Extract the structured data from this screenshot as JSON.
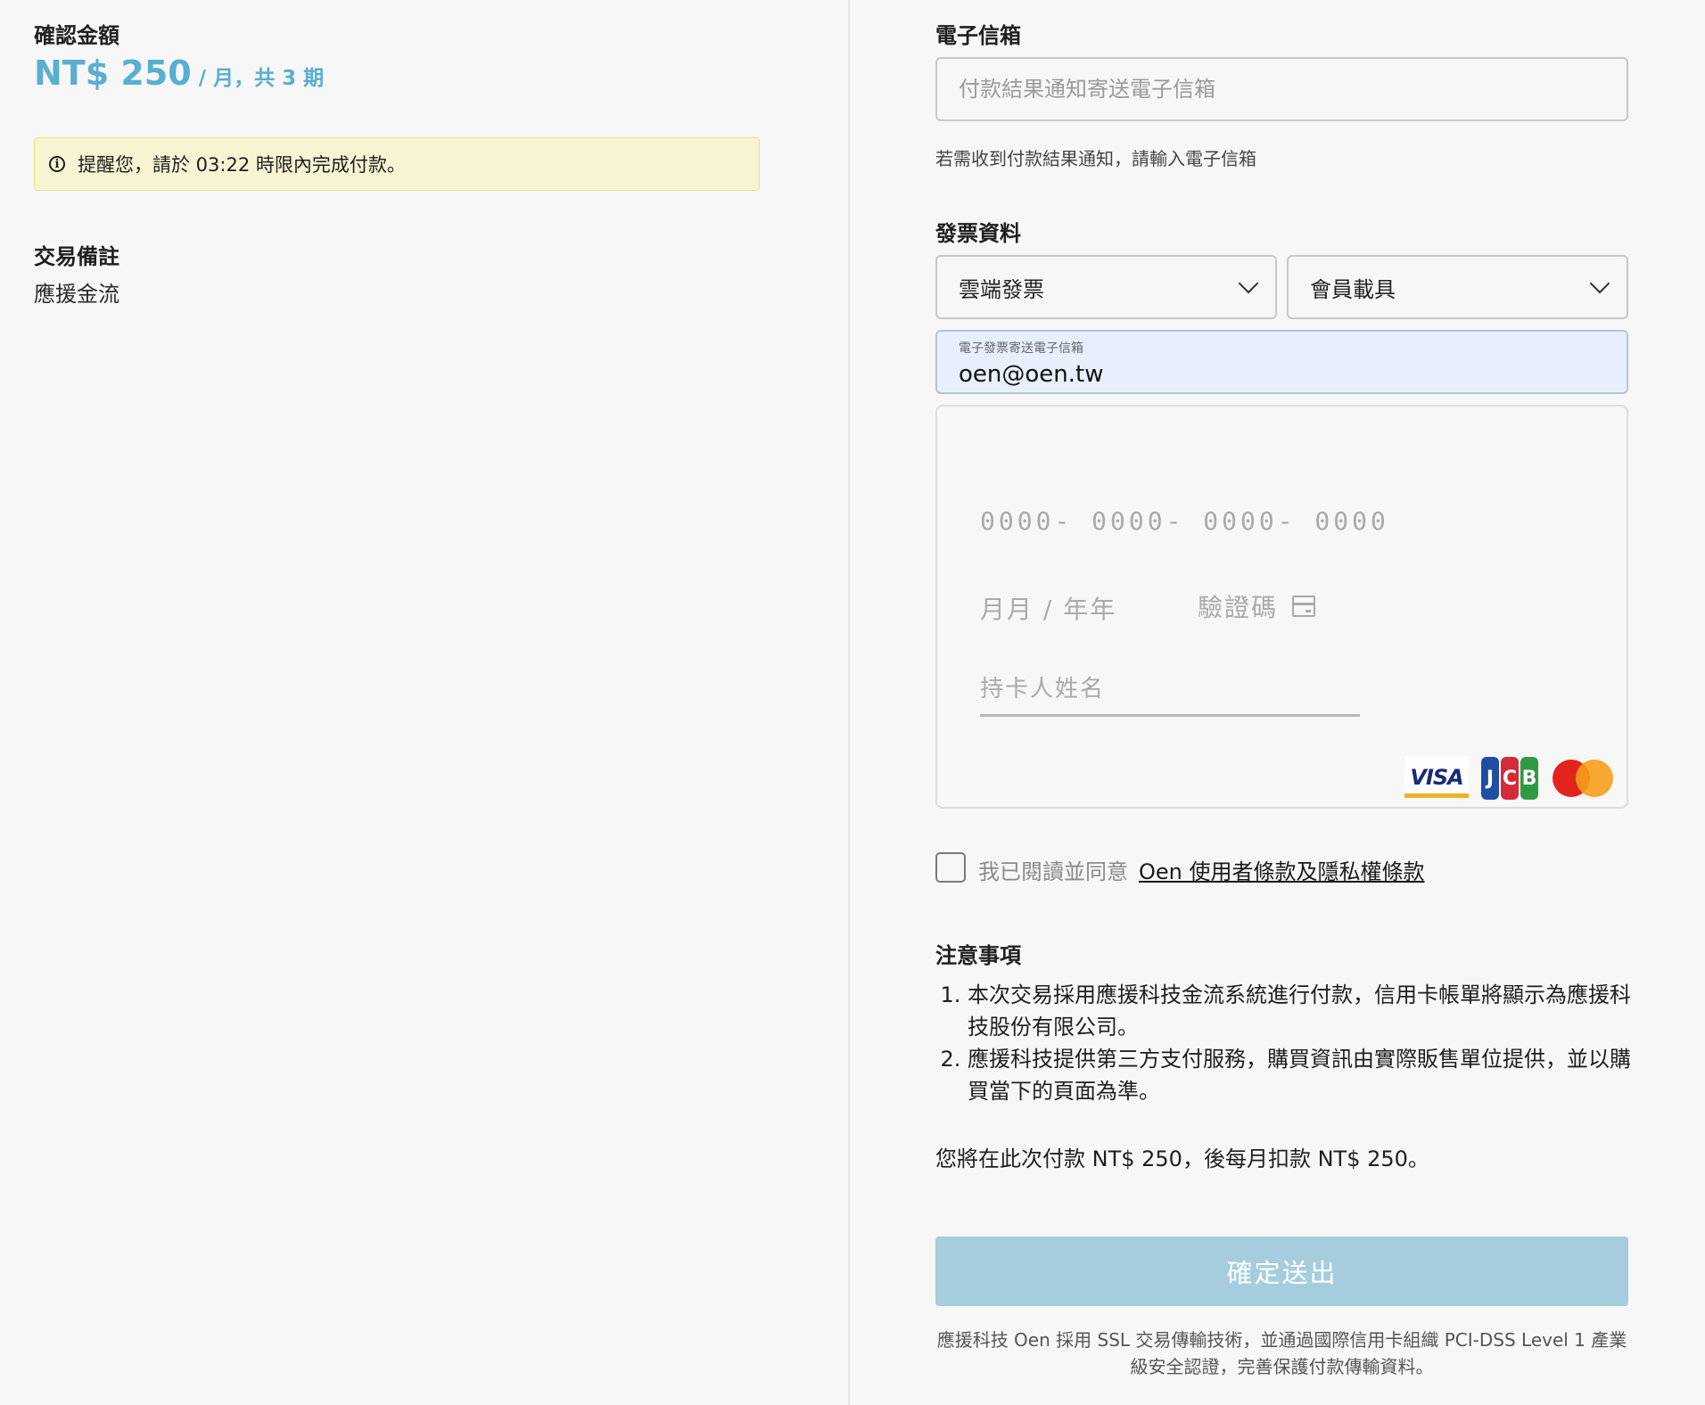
{
  "left": {
    "amount_label": "確認金額",
    "amount": "NT$ 250",
    "period": "/ 月，共 3 期",
    "notice": "提醒您，請於 03:22 時限內完成付款。",
    "remark_label": "交易備註",
    "remark_value": "應援金流"
  },
  "right": {
    "email_label": "電子信箱",
    "email_placeholder": "付款結果通知寄送電子信箱",
    "email_hint": "若需收到付款結果通知，請輸入電子信箱",
    "invoice_label": "發票資料",
    "invoice_type": "雲端發票",
    "carrier_type": "會員載具",
    "invoice_email_label": "電子發票寄送電子信箱",
    "invoice_email": "oen@oen.tw",
    "card": {
      "number_placeholder": "0000- 0000- 0000- 0000",
      "expiry_placeholder": "月月 / 年年",
      "cvc_placeholder": "驗證碼",
      "name_placeholder": "持卡人姓名",
      "brands": [
        "VISA",
        "JCB",
        "Mastercard"
      ]
    },
    "agree_text": "我已閱讀並同意",
    "agree_link": "Oen 使用者條款及隱私權條款",
    "notes_title": "注意事項",
    "notes": [
      "本次交易採用應援科技金流系統進行付款，信用卡帳單將顯示為應援科技股份有限公司。",
      "應援科技提供第三方支付服務，購買資訊由實際販售單位提供，並以購買當下的頁面為準。"
    ],
    "summary": "您將在此次付款 NT$ 250，後每月扣款 NT$ 250。",
    "submit_label": "確定送出",
    "footer": "應援科技 Oen 採用 SSL 交易傳輸技術，並通過國際信用卡組織 PCI-DSS Level 1 產業級安全認證，完善保護付款傳輸資料。"
  },
  "colors": {
    "accent": "#5aaed0",
    "notice_bg": "#f7f4d4",
    "button_bg": "#a5cddd"
  }
}
